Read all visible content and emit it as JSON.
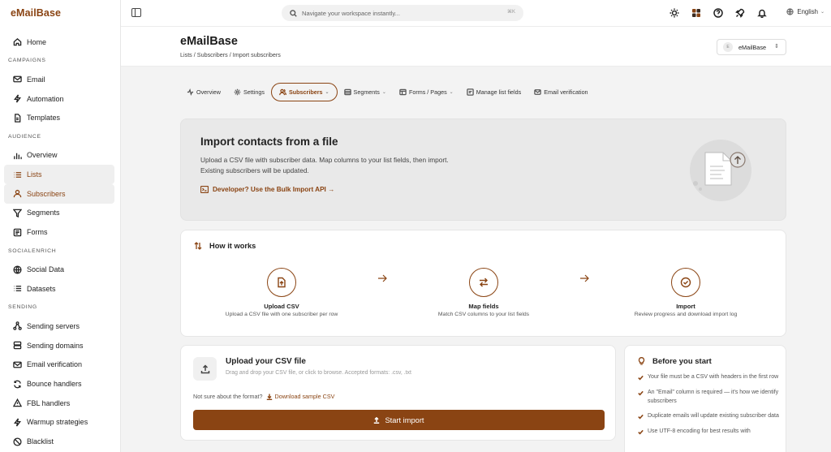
{
  "app": {
    "logo": "eMailBase"
  },
  "sidebar": {
    "home": "Home",
    "sections": {
      "campaigns": "CAMPAIGNS",
      "audience": "AUDIENCE",
      "socialenrich": "SOCIALENRICH",
      "sending": "SENDING"
    },
    "campaigns": [
      "Email",
      "Automation",
      "Templates"
    ],
    "audience": [
      "Overview",
      "Lists",
      "Subscribers",
      "Segments",
      "Forms"
    ],
    "socialenrich": [
      "Social Data",
      "Datasets"
    ],
    "sending": [
      "Sending servers",
      "Sending domains",
      "Email verification",
      "Bounce handlers",
      "FBL handlers",
      "Warmup strategies",
      "Blacklist"
    ]
  },
  "topbar": {
    "search_placeholder": "Navigate your workspace instantly...",
    "shortcut": "⌘K",
    "language": "English"
  },
  "header": {
    "title": "eMailBase",
    "breadcrumbs": [
      "Lists",
      "Subscribers",
      "Import subscribers"
    ],
    "account": "eMailBase",
    "account_initial": "E"
  },
  "tabs": [
    "Overview",
    "Settings",
    "Subscribers",
    "Segments",
    "Forms / Pages",
    "Manage list fields",
    "Email verification"
  ],
  "hero": {
    "title": "Import contacts from a file",
    "description": "Upload a CSV file with subscriber data. Map columns to your list fields, then import. Existing subscribers will be updated.",
    "api_link": "Developer? Use the Bulk Import API →"
  },
  "how": {
    "title": "How it works",
    "steps": [
      {
        "title": "Upload CSV",
        "desc": "Upload a CSV file with one subscriber per row"
      },
      {
        "title": "Map fields",
        "desc": "Match CSV columns to your list fields"
      },
      {
        "title": "Import",
        "desc": "Review progress and download import log"
      }
    ]
  },
  "upload": {
    "title": "Upload your CSV file",
    "hint": "Drag and drop your CSV file, or click to browse. Accepted formats: .csv, .txt",
    "not_sure": "Not sure about the format?",
    "sample_link": "Download sample CSV",
    "start_button": "Start import"
  },
  "before": {
    "title": "Before you start",
    "items": [
      "Your file must be a CSV with headers in the first row",
      "An \"Email\" column is required — it's how we identify subscribers",
      "Duplicate emails will update existing subscriber data",
      "Use UTF-8 encoding for best results with"
    ]
  },
  "colors": {
    "accent": "#8a4413",
    "hero_bg": "#e9e9e9",
    "page_bg": "#f3f3f3"
  }
}
